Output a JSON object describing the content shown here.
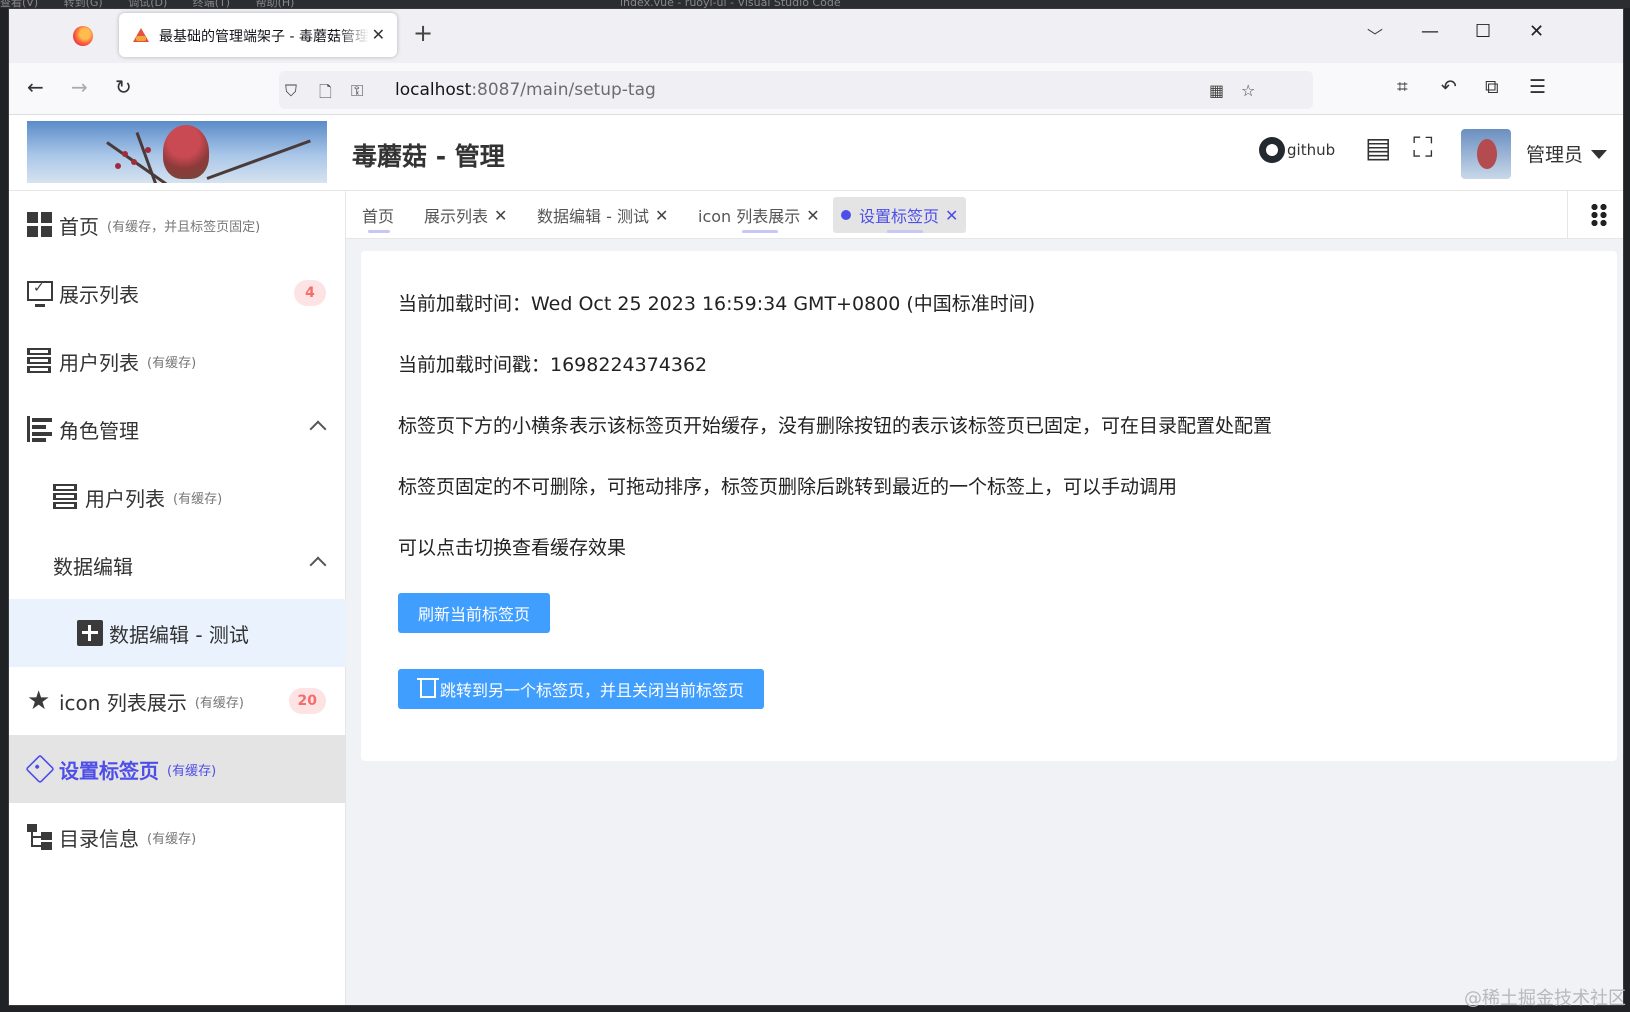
{
  "vscode": {
    "menu": [
      "查看(V)",
      "转到(G)",
      "调试(D)",
      "终端(T)",
      "帮助(H)"
    ],
    "title": "index.vue - ruoyi-ui - Visual Studio Code"
  },
  "browser": {
    "tab_title": "最基础的管理端架子 - 毒蘑菇管理",
    "url_host": "localhost",
    "url_rest": ":8087/main/setup-tag"
  },
  "header": {
    "title": "毒蘑菇 - 管理",
    "github_label": "github",
    "user_name": "管理员"
  },
  "sidebar": {
    "items": [
      {
        "label": "首页",
        "sub": "(有缓存，并且标签页固定)"
      },
      {
        "label": "展示列表",
        "badge": "4"
      },
      {
        "label": "用户列表",
        "sub": "(有缓存)"
      },
      {
        "label": "角色管理"
      },
      {
        "label": "用户列表",
        "sub": "(有缓存)"
      },
      {
        "label": "数据编辑"
      },
      {
        "label": "数据编辑 - 测试"
      },
      {
        "label": "icon 列表展示",
        "sub": "(有缓存)",
        "badge": "20"
      },
      {
        "label": "设置标签页",
        "sub": "(有缓存)"
      },
      {
        "label": "目录信息",
        "sub": "(有缓存)"
      }
    ]
  },
  "tags": [
    {
      "label": "首页"
    },
    {
      "label": "展示列表"
    },
    {
      "label": "数据编辑 - 测试"
    },
    {
      "label": "icon 列表展示"
    },
    {
      "label": "设置标签页"
    }
  ],
  "content": {
    "load_time": "当前加载时间：Wed Oct 25 2023 16:59:34 GMT+0800 (中国标准时间)",
    "load_timestamp": "当前加载时间戳：1698224374362",
    "note1": "标签页下方的小横条表示该标签页开始缓存，没有删除按钮的表示该标签页已固定，可在目录配置处配置",
    "note2": "标签页固定的不可删除，可拖动排序，标签页删除后跳转到最近的一个标签上，可以手动调用",
    "note3": "可以点击切换查看缓存效果",
    "btn_refresh": "刷新当前标签页",
    "btn_jump_close": "跳转到另一个标签页，并且关闭当前标签页"
  },
  "watermark": "@稀土掘金技术社区",
  "colors": {
    "accent": "#4e4ee8",
    "primary_button": "#409eff",
    "badge_text": "#f56c6c"
  }
}
